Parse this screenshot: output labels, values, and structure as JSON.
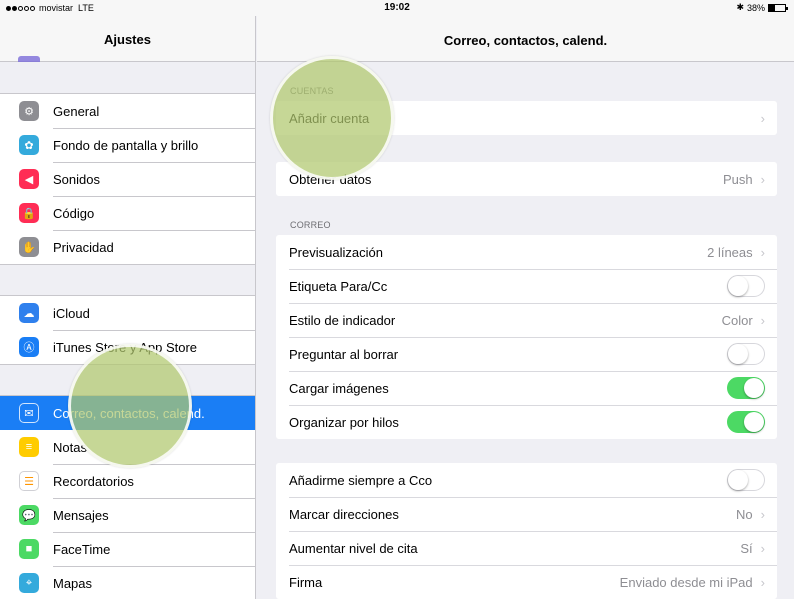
{
  "status": {
    "carrier": "movistar",
    "network": "LTE",
    "time": "19:02",
    "bluetooth": "✱",
    "battery": "38%",
    "battery_level": 0.38
  },
  "sidebar": {
    "title": "Ajustes",
    "groups": [
      [
        {
          "label": "General",
          "icon": "gear-icon",
          "color": "#8e8e93"
        },
        {
          "label": "Fondo de pantalla y brillo",
          "icon": "flower-icon",
          "color": "#34aadc"
        },
        {
          "label": "Sonidos",
          "icon": "speaker-icon",
          "color": "#ff2d55"
        },
        {
          "label": "Código",
          "icon": "lock-icon",
          "color": "#ff2d55"
        },
        {
          "label": "Privacidad",
          "icon": "hand-icon",
          "color": "#8e8e93"
        }
      ],
      [
        {
          "label": "iCloud",
          "icon": "cloud-icon",
          "color": "#2f80ed"
        },
        {
          "label": "iTunes Store y App Store",
          "icon": "app-store-icon",
          "color": "#1a7ef5"
        }
      ],
      [
        {
          "label": "Correo, contactos, calend.",
          "icon": "mail-icon",
          "color": "#1a7ef5",
          "active": true
        },
        {
          "label": "Notas",
          "icon": "notes-icon",
          "color": "#ffcc00"
        },
        {
          "label": "Recordatorios",
          "icon": "list-icon",
          "color": "#ffffff"
        },
        {
          "label": "Mensajes",
          "icon": "message-icon",
          "color": "#4cd964"
        },
        {
          "label": "FaceTime",
          "icon": "video-icon",
          "color": "#4cd964"
        },
        {
          "label": "Mapas",
          "icon": "map-icon",
          "color": "#34aadc"
        }
      ]
    ]
  },
  "main": {
    "title": "Correo, contactos, calend.",
    "cuentas_header": "CUENTAS",
    "add_account": "Añadir cuenta",
    "fetch": {
      "label": "Obtener datos",
      "value": "Push"
    },
    "correo_header": "CORREO",
    "correo_rows": [
      {
        "label": "Previsualización",
        "value": "2 líneas",
        "type": "disclosure"
      },
      {
        "label": "Etiqueta Para/Cc",
        "type": "toggle",
        "on": false
      },
      {
        "label": "Estilo de indicador",
        "value": "Color",
        "type": "disclosure"
      },
      {
        "label": "Preguntar al borrar",
        "type": "toggle",
        "on": false
      },
      {
        "label": "Cargar imágenes",
        "type": "toggle",
        "on": true
      },
      {
        "label": "Organizar por hilos",
        "type": "toggle",
        "on": true
      }
    ],
    "more_rows": [
      {
        "label": "Añadirme siempre a Cco",
        "type": "toggle",
        "on": false
      },
      {
        "label": "Marcar direcciones",
        "value": "No",
        "type": "disclosure"
      },
      {
        "label": "Aumentar nivel de cita",
        "value": "Sí",
        "type": "disclosure"
      },
      {
        "label": "Firma",
        "value": "Enviado desde mi iPad",
        "type": "disclosure"
      }
    ],
    "chevron": "›"
  }
}
